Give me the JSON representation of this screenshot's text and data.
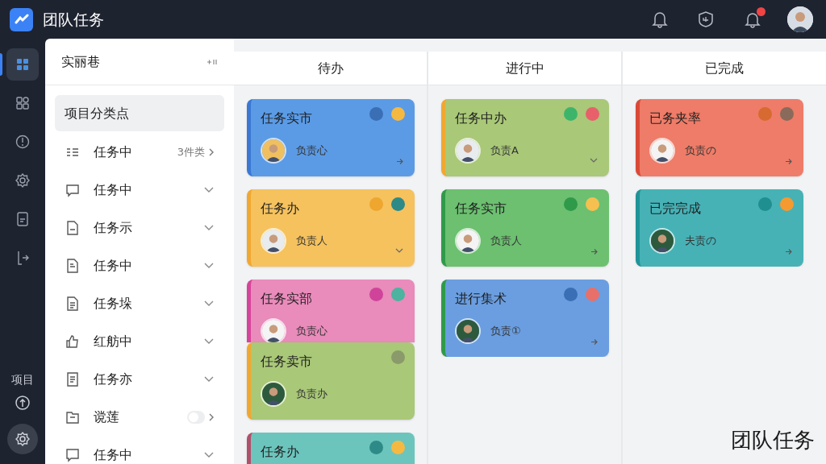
{
  "app": {
    "title": "团队任务"
  },
  "topbar": {
    "bell_badge": true
  },
  "rail": {
    "items": [
      {
        "selected": true
      },
      {
        "selected": false
      },
      {
        "selected": false
      },
      {
        "selected": false
      },
      {
        "selected": false
      },
      {
        "selected": false
      }
    ],
    "label": "项目"
  },
  "panel": {
    "title": "实丽巷",
    "items": [
      {
        "label": "项目分类点",
        "selected": true,
        "kind": "plain"
      },
      {
        "label": "任务中",
        "selected": false,
        "kind": "count",
        "count": "3件类"
      },
      {
        "label": "任务中",
        "selected": false,
        "kind": "chevron"
      },
      {
        "label": "任务示",
        "selected": false,
        "kind": "chevron"
      },
      {
        "label": "任务中",
        "selected": false,
        "kind": "chevron"
      },
      {
        "label": "任务垛",
        "selected": false,
        "kind": "chevron"
      },
      {
        "label": "红舫中",
        "selected": false,
        "kind": "chevron"
      },
      {
        "label": "任务亦",
        "selected": false,
        "kind": "chevron"
      },
      {
        "label": "谠莲",
        "selected": false,
        "kind": "toggle",
        "on": false
      },
      {
        "label": "任务中",
        "selected": false,
        "kind": "chevron"
      }
    ]
  },
  "board": {
    "columns": [
      {
        "title": "待办",
        "cards": [
          {
            "title": "任务实市",
            "color": "#5b9be6",
            "stripe": {
              "color": "#3a78d4"
            },
            "dots": [
              {
                "color": "#3a6fb5"
              },
              {
                "color": "#f5b942"
              }
            ],
            "assignee": "负责心",
            "kind": "arrow"
          },
          {
            "title": "任务办",
            "color": "#f5c25e",
            "stripe": {
              "color": "#f0a830"
            },
            "dots": [
              {
                "color": "#eea62e"
              },
              {
                "color": "#2e8a87"
              }
            ],
            "assignee": "负责人",
            "kind": "chevron"
          },
          {
            "title": "任务实部",
            "color": "#e98bbb",
            "stripe": {
              "color": "#d6449a"
            },
            "dots": [
              {
                "color": "#d0439a"
              },
              {
                "color": "#4bb3a0"
              }
            ],
            "assignee": "负责心",
            "kind": "plain",
            "covered": true
          },
          {
            "title": "任务卖市",
            "color": "#a9c878",
            "stripe": {
              "color": "#f0a830"
            },
            "dots": [
              {
                "color": "#8a9a6a"
              }
            ],
            "assignee": "负责办",
            "kind": "plain"
          },
          {
            "title": "任务办",
            "color": "#6cc5bd",
            "stripe": {
              "color": "#b0506a"
            },
            "dots": [
              {
                "color": "#2e8a87"
              },
              {
                "color": "#f5b942"
              }
            ],
            "kind": "plain"
          }
        ]
      },
      {
        "title": "进行中",
        "cards": [
          {
            "title": "任务中办",
            "color": "#a9c878",
            "stripe": {
              "color": "#f0a830"
            },
            "dots": [
              {
                "color": "#3cb56a"
              },
              {
                "color": "#e8606a"
              }
            ],
            "assignee": "负责A",
            "kind": "chevron"
          },
          {
            "title": "任务实市",
            "color": "#6cc070",
            "stripe": {
              "color": "#2f9a4a"
            },
            "dots": [
              {
                "color": "#2f9a4a"
              },
              {
                "color": "#f5c050"
              }
            ],
            "assignee": "负责人",
            "kind": "arrow"
          },
          {
            "title": "进行集术",
            "color": "#6a9ee0",
            "stripe": {
              "color": "#2f9a4a"
            },
            "dots": [
              {
                "color": "#3a6fb5"
              },
              {
                "color": "#e8706a"
              }
            ],
            "assignee": "负责①",
            "kind": "arrow"
          }
        ]
      },
      {
        "title": "已完成",
        "cards": [
          {
            "title": "已务夹率",
            "color": "#ee7c68",
            "stripe": {
              "color": "#d94a36"
            },
            "dots": [
              {
                "color": "#d66a30"
              },
              {
                "color": "#8a6a5a"
              }
            ],
            "assignee": "负责の",
            "kind": "arrow"
          },
          {
            "title": "已完完成",
            "color": "#46b2b6",
            "stripe": {
              "color": "#1f9499"
            },
            "dots": [
              {
                "color": "#1f8f8f"
              },
              {
                "color": "#f59a30"
              }
            ],
            "assignee": "夫责の",
            "kind": "arrow"
          }
        ]
      }
    ]
  },
  "caption": "团队任务"
}
